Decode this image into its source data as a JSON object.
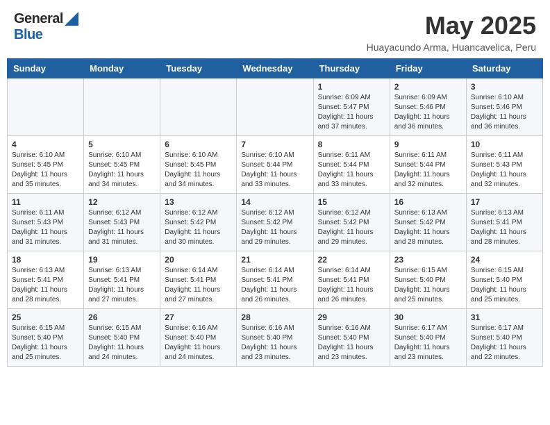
{
  "header": {
    "logo_general": "General",
    "logo_blue": "Blue",
    "title": "May 2025",
    "subtitle": "Huayacundo Arma, Huancavelica, Peru"
  },
  "calendar": {
    "days_of_week": [
      "Sunday",
      "Monday",
      "Tuesday",
      "Wednesday",
      "Thursday",
      "Friday",
      "Saturday"
    ],
    "weeks": [
      [
        {
          "day": "",
          "info": ""
        },
        {
          "day": "",
          "info": ""
        },
        {
          "day": "",
          "info": ""
        },
        {
          "day": "",
          "info": ""
        },
        {
          "day": "1",
          "info": "Sunrise: 6:09 AM\nSunset: 5:47 PM\nDaylight: 11 hours\nand 37 minutes."
        },
        {
          "day": "2",
          "info": "Sunrise: 6:09 AM\nSunset: 5:46 PM\nDaylight: 11 hours\nand 36 minutes."
        },
        {
          "day": "3",
          "info": "Sunrise: 6:10 AM\nSunset: 5:46 PM\nDaylight: 11 hours\nand 36 minutes."
        }
      ],
      [
        {
          "day": "4",
          "info": "Sunrise: 6:10 AM\nSunset: 5:45 PM\nDaylight: 11 hours\nand 35 minutes."
        },
        {
          "day": "5",
          "info": "Sunrise: 6:10 AM\nSunset: 5:45 PM\nDaylight: 11 hours\nand 34 minutes."
        },
        {
          "day": "6",
          "info": "Sunrise: 6:10 AM\nSunset: 5:45 PM\nDaylight: 11 hours\nand 34 minutes."
        },
        {
          "day": "7",
          "info": "Sunrise: 6:10 AM\nSunset: 5:44 PM\nDaylight: 11 hours\nand 33 minutes."
        },
        {
          "day": "8",
          "info": "Sunrise: 6:11 AM\nSunset: 5:44 PM\nDaylight: 11 hours\nand 33 minutes."
        },
        {
          "day": "9",
          "info": "Sunrise: 6:11 AM\nSunset: 5:44 PM\nDaylight: 11 hours\nand 32 minutes."
        },
        {
          "day": "10",
          "info": "Sunrise: 6:11 AM\nSunset: 5:43 PM\nDaylight: 11 hours\nand 32 minutes."
        }
      ],
      [
        {
          "day": "11",
          "info": "Sunrise: 6:11 AM\nSunset: 5:43 PM\nDaylight: 11 hours\nand 31 minutes."
        },
        {
          "day": "12",
          "info": "Sunrise: 6:12 AM\nSunset: 5:43 PM\nDaylight: 11 hours\nand 31 minutes."
        },
        {
          "day": "13",
          "info": "Sunrise: 6:12 AM\nSunset: 5:42 PM\nDaylight: 11 hours\nand 30 minutes."
        },
        {
          "day": "14",
          "info": "Sunrise: 6:12 AM\nSunset: 5:42 PM\nDaylight: 11 hours\nand 29 minutes."
        },
        {
          "day": "15",
          "info": "Sunrise: 6:12 AM\nSunset: 5:42 PM\nDaylight: 11 hours\nand 29 minutes."
        },
        {
          "day": "16",
          "info": "Sunrise: 6:13 AM\nSunset: 5:42 PM\nDaylight: 11 hours\nand 28 minutes."
        },
        {
          "day": "17",
          "info": "Sunrise: 6:13 AM\nSunset: 5:41 PM\nDaylight: 11 hours\nand 28 minutes."
        }
      ],
      [
        {
          "day": "18",
          "info": "Sunrise: 6:13 AM\nSunset: 5:41 PM\nDaylight: 11 hours\nand 28 minutes."
        },
        {
          "day": "19",
          "info": "Sunrise: 6:13 AM\nSunset: 5:41 PM\nDaylight: 11 hours\nand 27 minutes."
        },
        {
          "day": "20",
          "info": "Sunrise: 6:14 AM\nSunset: 5:41 PM\nDaylight: 11 hours\nand 27 minutes."
        },
        {
          "day": "21",
          "info": "Sunrise: 6:14 AM\nSunset: 5:41 PM\nDaylight: 11 hours\nand 26 minutes."
        },
        {
          "day": "22",
          "info": "Sunrise: 6:14 AM\nSunset: 5:41 PM\nDaylight: 11 hours\nand 26 minutes."
        },
        {
          "day": "23",
          "info": "Sunrise: 6:15 AM\nSunset: 5:40 PM\nDaylight: 11 hours\nand 25 minutes."
        },
        {
          "day": "24",
          "info": "Sunrise: 6:15 AM\nSunset: 5:40 PM\nDaylight: 11 hours\nand 25 minutes."
        }
      ],
      [
        {
          "day": "25",
          "info": "Sunrise: 6:15 AM\nSunset: 5:40 PM\nDaylight: 11 hours\nand 25 minutes."
        },
        {
          "day": "26",
          "info": "Sunrise: 6:15 AM\nSunset: 5:40 PM\nDaylight: 11 hours\nand 24 minutes."
        },
        {
          "day": "27",
          "info": "Sunrise: 6:16 AM\nSunset: 5:40 PM\nDaylight: 11 hours\nand 24 minutes."
        },
        {
          "day": "28",
          "info": "Sunrise: 6:16 AM\nSunset: 5:40 PM\nDaylight: 11 hours\nand 23 minutes."
        },
        {
          "day": "29",
          "info": "Sunrise: 6:16 AM\nSunset: 5:40 PM\nDaylight: 11 hours\nand 23 minutes."
        },
        {
          "day": "30",
          "info": "Sunrise: 6:17 AM\nSunset: 5:40 PM\nDaylight: 11 hours\nand 23 minutes."
        },
        {
          "day": "31",
          "info": "Sunrise: 6:17 AM\nSunset: 5:40 PM\nDaylight: 11 hours\nand 22 minutes."
        }
      ]
    ]
  }
}
